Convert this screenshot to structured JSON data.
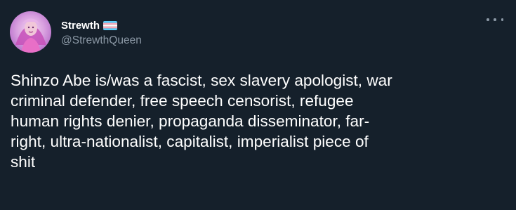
{
  "author": {
    "display_name": "Strewth",
    "handle": "@StrewthQueen",
    "flag_icon": "transgender-flag-icon"
  },
  "menu": {
    "icon": "more-options-icon"
  },
  "tweet": {
    "text": "Shinzo Abe is/was a fascist, sex slavery apologist, war\ncriminal defender, free speech censorist, refugee\nhuman rights denier, propaganda disseminator, far-\nright, ultra-nationalist, capitalist, imperialist piece of\nshit"
  },
  "colors": {
    "background": "#15202b",
    "text_primary": "#ffffff",
    "text_secondary": "#8b98a5",
    "flag_blue": "#5bcefa",
    "flag_pink": "#f5a9b8",
    "flag_white": "#ffffff"
  }
}
